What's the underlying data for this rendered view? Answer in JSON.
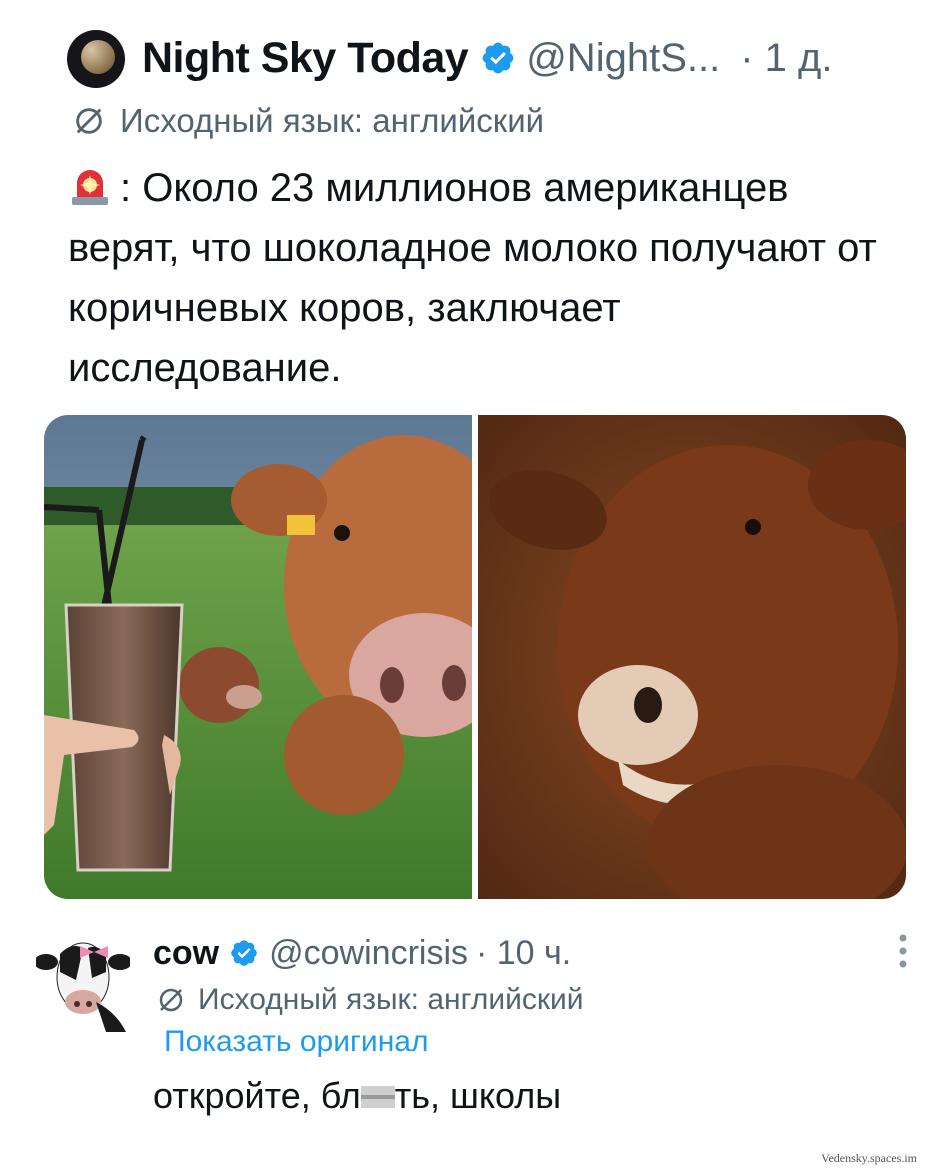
{
  "tweet": {
    "author_name": "Night Sky Today",
    "author_handle": "@NightS...",
    "time": "· 1 д.",
    "translation_note": "Исходный язык: английский",
    "text_after_emoji": ": Около 23 миллионов американцев верят, что шоколадное молоко получают от коричневых коров, заключает исследование.",
    "icons": [
      "avatar-planet",
      "verified-badge",
      "translate-icon",
      "police-siren-emoji"
    ]
  },
  "images": [
    {
      "description": "chocolate milk glass with straws next to brown cows in field"
    },
    {
      "description": "close-up of brown cow face"
    }
  ],
  "reply": {
    "author_name": "cow",
    "author_handle": "@cowincrisis",
    "time": "· 10 ч.",
    "translation_note": "Исходный язык: английский",
    "show_original": "Показать оригинал",
    "text_before": "откройте, бл",
    "text_after": "ть, школы",
    "icons": [
      "cow-avatar",
      "verified-badge",
      "translate-icon",
      "more-dots-icon"
    ]
  },
  "watermark": "Vedensky.spaces.im",
  "colors": {
    "accent": "#1d9bf0",
    "text": "#0f1419",
    "muted": "#536471"
  }
}
